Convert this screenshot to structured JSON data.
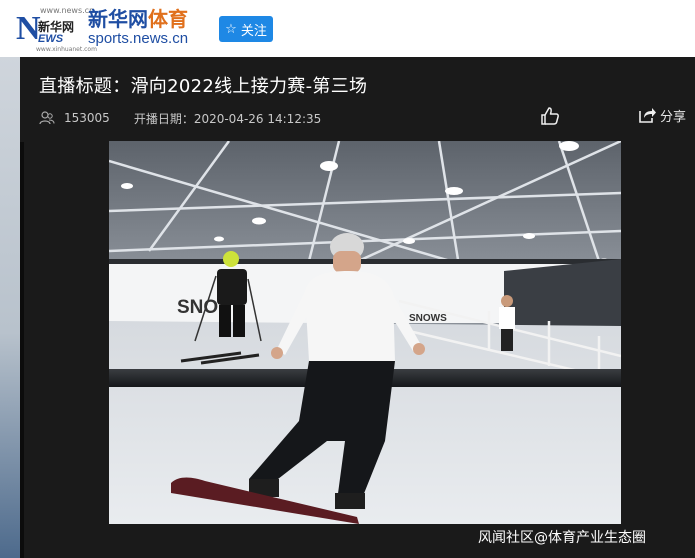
{
  "header": {
    "logo_top_url": "www.news.cn",
    "logo_letter": "N",
    "logo_zh": "新华网",
    "logo_ews": "EWS",
    "logo_bottom_url": "www.xinhuanet.com",
    "sports_logo_cn_a": "新华网",
    "sports_logo_cn_b": "体育",
    "sports_logo_en": "sports.news.cn",
    "follow_icon": "☆",
    "follow_label": "关注"
  },
  "live": {
    "title": "直播标题：滑向2022线上接力赛-第三场",
    "viewer_count": "153005",
    "start_time": "开播日期：2020-04-26 14:12:35",
    "share_label": "分享"
  },
  "video": {
    "banner_text_left": "SNO",
    "banner_text_right": "SNOWS"
  },
  "watermark": "风闻社区@体育产业生态圈",
  "colors": {
    "brand_blue": "#1f4ea3",
    "brand_orange": "#e0701c",
    "follow_button": "#1e88e5",
    "page_dark": "#1a1a1a"
  },
  "icons": {
    "viewers": "user-icon",
    "like": "thumbs-up-icon",
    "share": "share-icon"
  }
}
